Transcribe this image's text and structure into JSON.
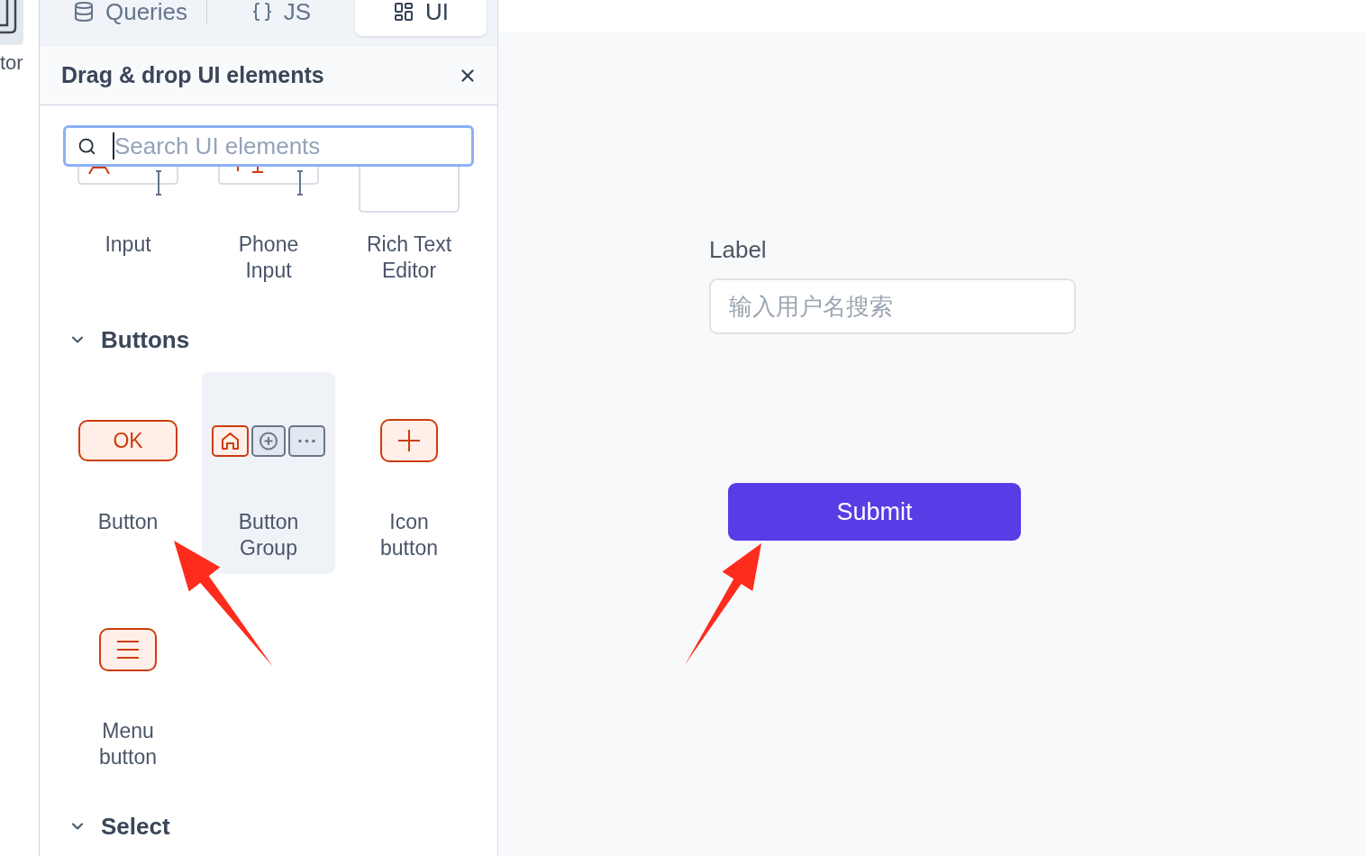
{
  "side_rail": {
    "label": "tor"
  },
  "tabs": [
    {
      "kind": "queries",
      "label": "Queries",
      "selected": false
    },
    {
      "kind": "js",
      "label": "JS",
      "selected": false
    },
    {
      "kind": "ui",
      "label": "UI",
      "selected": true
    }
  ],
  "panel": {
    "title": "Drag & drop UI elements",
    "search": {
      "placeholder": "Search UI elements",
      "focused": true
    },
    "sections": [
      {
        "items": [
          {
            "kind": "input",
            "label": "Input",
            "highlighted": false
          },
          {
            "kind": "phone_input",
            "label": "Phone Input",
            "highlighted": false
          },
          {
            "kind": "rich_text_editor",
            "label": "Rich Text Editor",
            "highlighted": false
          }
        ]
      },
      {
        "title": "Buttons",
        "expanded": true,
        "items": [
          {
            "kind": "button",
            "label": "Button",
            "preview_text": "OK",
            "highlighted": false
          },
          {
            "kind": "button_group",
            "label": "Button Group",
            "highlighted": true
          },
          {
            "kind": "icon_button",
            "label": "Icon button",
            "highlighted": false
          },
          {
            "kind": "menu_button",
            "label": "Menu button",
            "highlighted": false
          }
        ]
      },
      {
        "title": "Select",
        "expanded": true
      }
    ]
  },
  "canvas": {
    "field_label": "Label",
    "input": {
      "placeholder": "输入用户名搜索"
    },
    "button": {
      "label": "Submit"
    }
  },
  "annotations": [
    {
      "kind": "arrow"
    },
    {
      "kind": "arrow"
    }
  ]
}
